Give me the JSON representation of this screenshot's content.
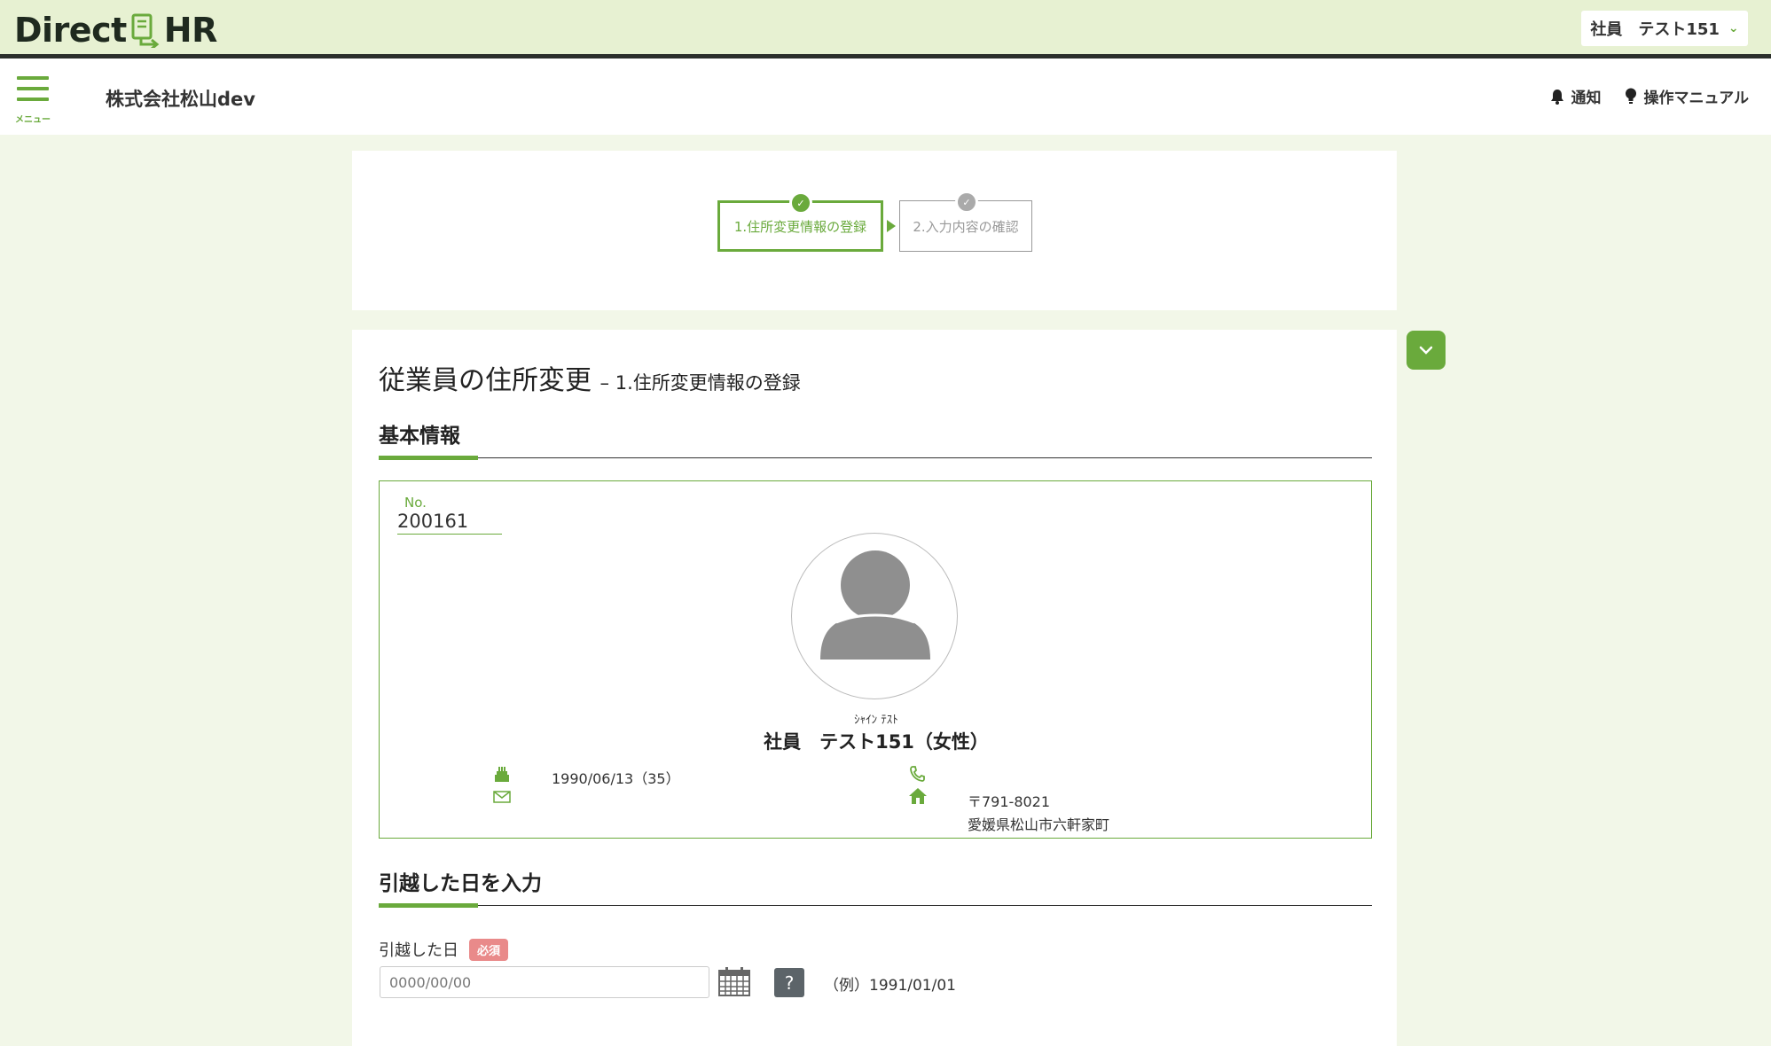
{
  "header": {
    "logo_left": "Direct",
    "logo_right": "HR",
    "user_label": "社員　テスト151"
  },
  "nav": {
    "menu_label": "メニュー",
    "company": "株式会社松山dev",
    "notification": "通知",
    "manual": "操作マニュアル"
  },
  "steps": [
    {
      "label": "1.住所変更情報の登録",
      "state": "active"
    },
    {
      "label": "2.入力内容の確認",
      "state": "inactive"
    }
  ],
  "page": {
    "title": "従業員の住所変更",
    "subtitle": "– 1.住所変更情報の登録"
  },
  "basic_info": {
    "section_title": "基本情報",
    "no_label": "No.",
    "no_value": "200161",
    "kana": "ｼｬｲﾝ ﾃｽﾄ",
    "name": "社員　テスト151（女性）",
    "birthday": "1990/06/13（35）",
    "email": "",
    "phone": "",
    "postal": "〒791-8021",
    "address": "愛媛県松山市六軒家町"
  },
  "move_section": {
    "section_title": "引越した日を入力",
    "field_label": "引越した日",
    "required": "必須",
    "placeholder": "0000/00/00",
    "help": "?",
    "example": "（例）1991/01/01"
  },
  "colors": {
    "accent": "#6aaa3c",
    "header_bg": "#e7f1d2",
    "page_bg": "#f2f7e8",
    "required": "#e98a8a"
  }
}
